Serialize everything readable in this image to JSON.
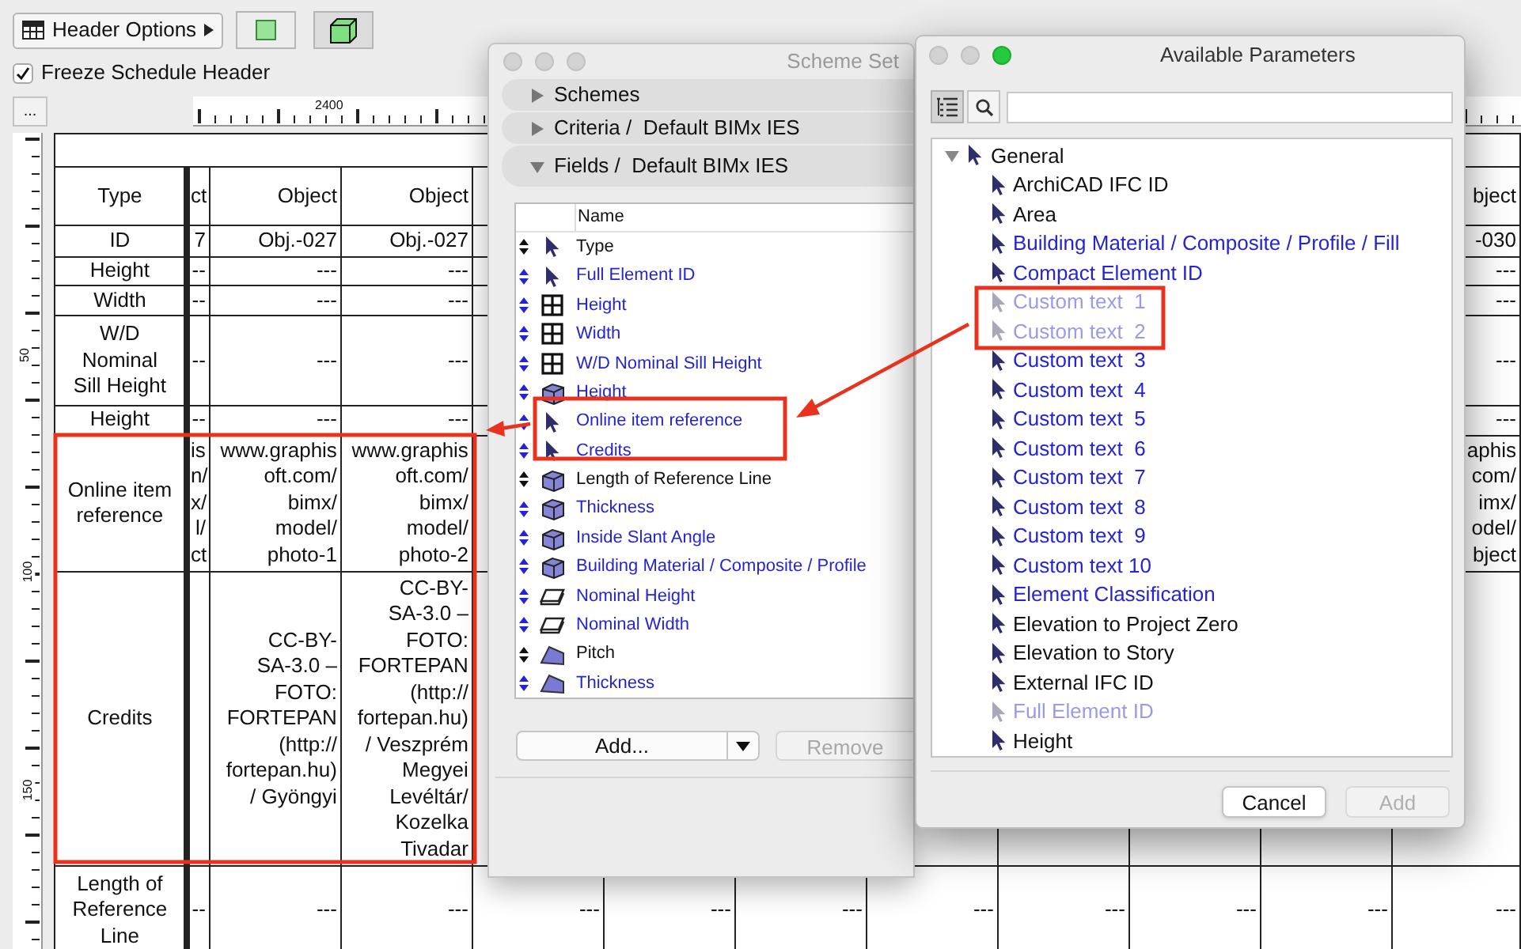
{
  "toolbar": {
    "header_options": "Header Options"
  },
  "freeze_header": {
    "label": "Freeze Schedule Header",
    "checked": true
  },
  "corner_button": "...",
  "top_ruler": {
    "label": "2400"
  },
  "side_ruler": {
    "labels": [
      "50",
      "100",
      "150"
    ]
  },
  "schedule": {
    "rows": [
      {
        "label": "Type",
        "cells": [
          "ct",
          "Object",
          "Object",
          null,
          null,
          null,
          null,
          null,
          null,
          null,
          "bject"
        ]
      },
      {
        "label": "ID",
        "cells": [
          "7",
          "Obj.-027",
          "Obj.-027",
          null,
          null,
          null,
          null,
          null,
          null,
          null,
          "-030"
        ]
      },
      {
        "label": "Height",
        "cells": [
          "--",
          "---",
          "---",
          null,
          null,
          null,
          null,
          null,
          null,
          null,
          "---"
        ]
      },
      {
        "label": "Width",
        "cells": [
          "--",
          "---",
          "---",
          null,
          null,
          null,
          null,
          null,
          null,
          null,
          "---"
        ]
      },
      {
        "label": "W/D Nominal Sill Height",
        "cells": [
          "--",
          "---",
          "---",
          null,
          null,
          null,
          null,
          null,
          null,
          null,
          "---"
        ]
      },
      {
        "label": "Height",
        "cells": [
          "--",
          "---",
          "---",
          null,
          null,
          null,
          null,
          null,
          null,
          null,
          "---"
        ]
      },
      {
        "label": "Online item reference",
        "cells": [
          "is\nn/\nx/\nl/\nct",
          "www.graphis\noft.com/\nbimx/\nmodel/\nphoto-1",
          "www.graphis\noft.com/\nbimx/\nmodel/\nphoto-2",
          null,
          null,
          null,
          null,
          null,
          null,
          null,
          "aphis\ncom/\nimx/\nodel/\nbject"
        ]
      },
      {
        "label": "Credits",
        "cells": [
          null,
          "CC-BY-\nSA-3.0 –\nFOTO:\nFORTEPAN\n(http://\nfortepan.hu)\n/ Gyöngyi",
          "CC-BY-\nSA-3.0 –\nFOTO:\nFORTEPAN\n(http://\nfortepan.hu)\n/ Veszprém\nMegyei\nLevéltár/\nKozelka\nTivadar",
          null,
          null,
          null,
          null,
          null,
          null,
          null,
          null
        ]
      },
      {
        "label": "Length of Reference Line",
        "cells": [
          "--",
          "---",
          "---",
          "---",
          "---",
          "---",
          "---",
          "---",
          "---",
          "---",
          "---"
        ]
      }
    ]
  },
  "scheme_window": {
    "title": "Scheme Set",
    "sections": [
      {
        "label": "Schemes",
        "expanded": false
      },
      {
        "label": "Criteria /  Default BIMx IES",
        "expanded": false
      },
      {
        "label": "Fields /  Default BIMx IES",
        "expanded": true
      }
    ],
    "list_header": "Name",
    "fields": [
      {
        "label": "Type",
        "kind": "pointer",
        "color": "#111111"
      },
      {
        "label": "Full Element ID",
        "kind": "pointer",
        "color": "#2424d4"
      },
      {
        "label": "Height",
        "kind": "grid",
        "color": "#2424d4"
      },
      {
        "label": "Width",
        "kind": "grid",
        "color": "#2424d4"
      },
      {
        "label": "W/D Nominal Sill Height",
        "kind": "grid",
        "color": "#2424d4"
      },
      {
        "label": "Height",
        "kind": "wall",
        "color": "#2424d4"
      },
      {
        "label": "Online item reference",
        "kind": "pointer",
        "color": "#2424d4"
      },
      {
        "label": "Credits",
        "kind": "pointer",
        "color": "#2424d4"
      },
      {
        "label": "Length of Reference Line",
        "kind": "wall",
        "color": "#111111"
      },
      {
        "label": "Thickness",
        "kind": "wall",
        "color": "#2424d4"
      },
      {
        "label": "Inside Slant Angle",
        "kind": "wall",
        "color": "#2424d4"
      },
      {
        "label": "Building Material / Composite / Profile",
        "kind": "wall",
        "color": "#2424d4"
      },
      {
        "label": "Nominal Height",
        "kind": "slab",
        "color": "#2424d4"
      },
      {
        "label": "Nominal Width",
        "kind": "slab",
        "color": "#2424d4"
      },
      {
        "label": "Pitch",
        "kind": "roof",
        "color": "#111111"
      },
      {
        "label": "Thickness",
        "kind": "roof",
        "color": "#2424d4"
      }
    ],
    "buttons": [
      {
        "label": "Add...",
        "kind": "menu",
        "disabled": false
      },
      {
        "label": "Remove",
        "kind": "plain",
        "disabled": true
      }
    ]
  },
  "params_window": {
    "title": "Available Parameters",
    "tree": [
      {
        "label": "General",
        "expanded": true,
        "children": [
          {
            "label": "ArchiCAD IFC ID",
            "color": "#111111",
            "disabled": false
          },
          {
            "label": "Area",
            "color": "#111111",
            "disabled": false
          },
          {
            "label": "Building Material / Composite / Profile / Fill",
            "color": "#2424d4",
            "disabled": false
          },
          {
            "label": "Compact Element ID",
            "color": "#2424d4",
            "disabled": false
          },
          {
            "label": "Custom text  1",
            "color": "#9a9ae8",
            "disabled": true
          },
          {
            "label": "Custom text  2",
            "color": "#9a9ae8",
            "disabled": true
          },
          {
            "label": "Custom text  3",
            "color": "#2424d4",
            "disabled": false
          },
          {
            "label": "Custom text  4",
            "color": "#2424d4",
            "disabled": false
          },
          {
            "label": "Custom text  5",
            "color": "#2424d4",
            "disabled": false
          },
          {
            "label": "Custom text  6",
            "color": "#2424d4",
            "disabled": false
          },
          {
            "label": "Custom text  7",
            "color": "#2424d4",
            "disabled": false
          },
          {
            "label": "Custom text  8",
            "color": "#2424d4",
            "disabled": false
          },
          {
            "label": "Custom text  9",
            "color": "#2424d4",
            "disabled": false
          },
          {
            "label": "Custom text 10",
            "color": "#2424d4",
            "disabled": false
          },
          {
            "label": "Element Classification",
            "color": "#2424d4",
            "disabled": false
          },
          {
            "label": "Elevation to Project Zero",
            "color": "#111111",
            "disabled": false
          },
          {
            "label": "Elevation to Story",
            "color": "#111111",
            "disabled": false
          },
          {
            "label": "External IFC ID",
            "color": "#111111",
            "disabled": false
          },
          {
            "label": "Full Element ID",
            "color": "#9a9ae8",
            "disabled": true
          },
          {
            "label": "Height",
            "color": "#111111",
            "disabled": false
          }
        ]
      }
    ],
    "buttons": [
      {
        "label": "Cancel",
        "disabled": false
      },
      {
        "label": "Add",
        "disabled": true
      }
    ]
  }
}
